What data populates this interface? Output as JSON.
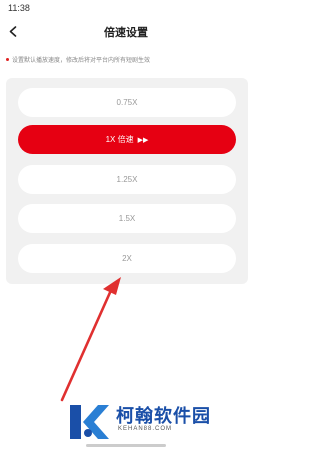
{
  "status_bar": {
    "time": "11:38"
  },
  "header": {
    "title": "倍速设置"
  },
  "hint": "设置默认播放速度，修改后将对平台内所有短剧生效",
  "speed_options": [
    {
      "label": "0.75X",
      "selected": false
    },
    {
      "label": "1X 倍速",
      "selected": true,
      "icon": "play-forward-icon"
    },
    {
      "label": "1.25X",
      "selected": false
    },
    {
      "label": "1.5X",
      "selected": false
    },
    {
      "label": "2X",
      "selected": false
    }
  ],
  "watermark": {
    "name": "柯翰软件园",
    "domain": "KEHAN88.COM"
  },
  "colors": {
    "accent": "#e60012",
    "panel_bg": "#f1f1f1",
    "option_bg": "#ffffff",
    "text_muted": "#999999",
    "watermark_blue": "#1a4fa8",
    "annotation_arrow": "#e03030"
  }
}
